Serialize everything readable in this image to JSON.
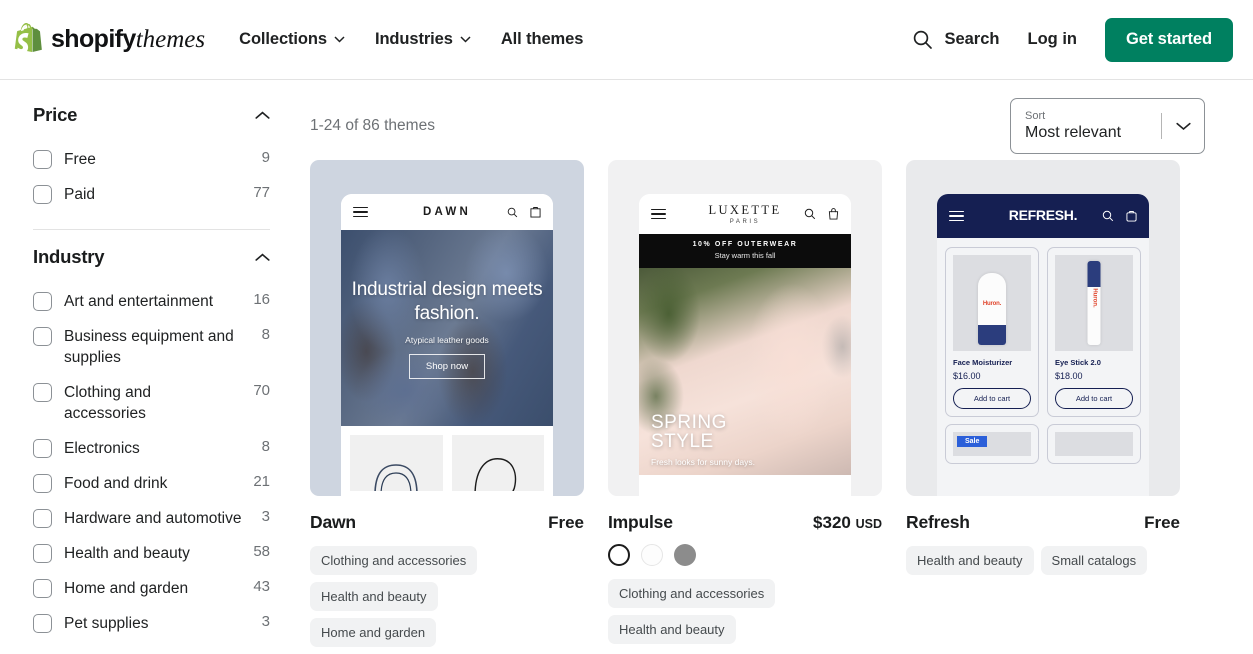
{
  "header": {
    "brand_bold": "shopify",
    "brand_light": "themes",
    "nav": [
      {
        "label": "Collections",
        "has_chevron": true
      },
      {
        "label": "Industries",
        "has_chevron": true
      },
      {
        "label": "All themes",
        "has_chevron": false
      }
    ],
    "search_label": "Search",
    "login_label": "Log in",
    "cta_label": "Get started",
    "cta_color": "#008060",
    "logo_green": "#95BF47",
    "logo_green_dark": "#5E8E3E"
  },
  "sidebar": {
    "price": {
      "title": "Price",
      "items": [
        {
          "label": "Free",
          "count": "9"
        },
        {
          "label": "Paid",
          "count": "77"
        }
      ]
    },
    "industry": {
      "title": "Industry",
      "items": [
        {
          "label": "Art and entertainment",
          "count": "16"
        },
        {
          "label": "Business equipment and supplies",
          "count": "8"
        },
        {
          "label": "Clothing and accessories",
          "count": "70"
        },
        {
          "label": "Electronics",
          "count": "8"
        },
        {
          "label": "Food and drink",
          "count": "21"
        },
        {
          "label": "Hardware and automotive",
          "count": "3"
        },
        {
          "label": "Health and beauty",
          "count": "58"
        },
        {
          "label": "Home and garden",
          "count": "43"
        },
        {
          "label": "Pet supplies",
          "count": "3"
        }
      ]
    }
  },
  "main": {
    "result_count": "1-24 of 86 themes",
    "sort": {
      "label": "Sort",
      "value": "Most relevant"
    }
  },
  "themes": [
    {
      "name": "Dawn",
      "price": "Free",
      "currency": "",
      "tags": [
        "Clothing and accessories",
        "Health and beauty",
        "Home and garden"
      ],
      "swatches": [],
      "preview": {
        "store_logo": "DAWN",
        "headline": "Industrial design meets fashion.",
        "subhead": "Atypical leather goods",
        "button": "Shop now"
      }
    },
    {
      "name": "Impulse",
      "price": "$320",
      "currency": "USD",
      "tags": [
        "Clothing and accessories",
        "Health and beauty"
      ],
      "swatches": [
        "#ffffff",
        "#fdfdfd",
        "#8c8c8c"
      ],
      "preview": {
        "store_logo": "LUXETTE",
        "store_logo_sub": "PARIS",
        "banner_1": "10% OFF OUTERWEAR",
        "banner_2": "Stay warm this fall",
        "headline_1": "SPRING",
        "headline_2": "STYLE",
        "subhead": "Fresh looks for sunny days."
      }
    },
    {
      "name": "Refresh",
      "price": "Free",
      "currency": "",
      "tags": [
        "Health and beauty",
        "Small catalogs"
      ],
      "swatches": [],
      "preview": {
        "store_logo": "REFRESH.",
        "products": [
          {
            "name": "Face Moisturizer",
            "price": "$16.00",
            "button": "Add to cart",
            "brand": "Huron."
          },
          {
            "name": "Eye Stick 2.0",
            "price": "$18.00",
            "button": "Add to cart",
            "brand": "Huron."
          }
        ],
        "sale_badge": "Sale"
      }
    }
  ]
}
